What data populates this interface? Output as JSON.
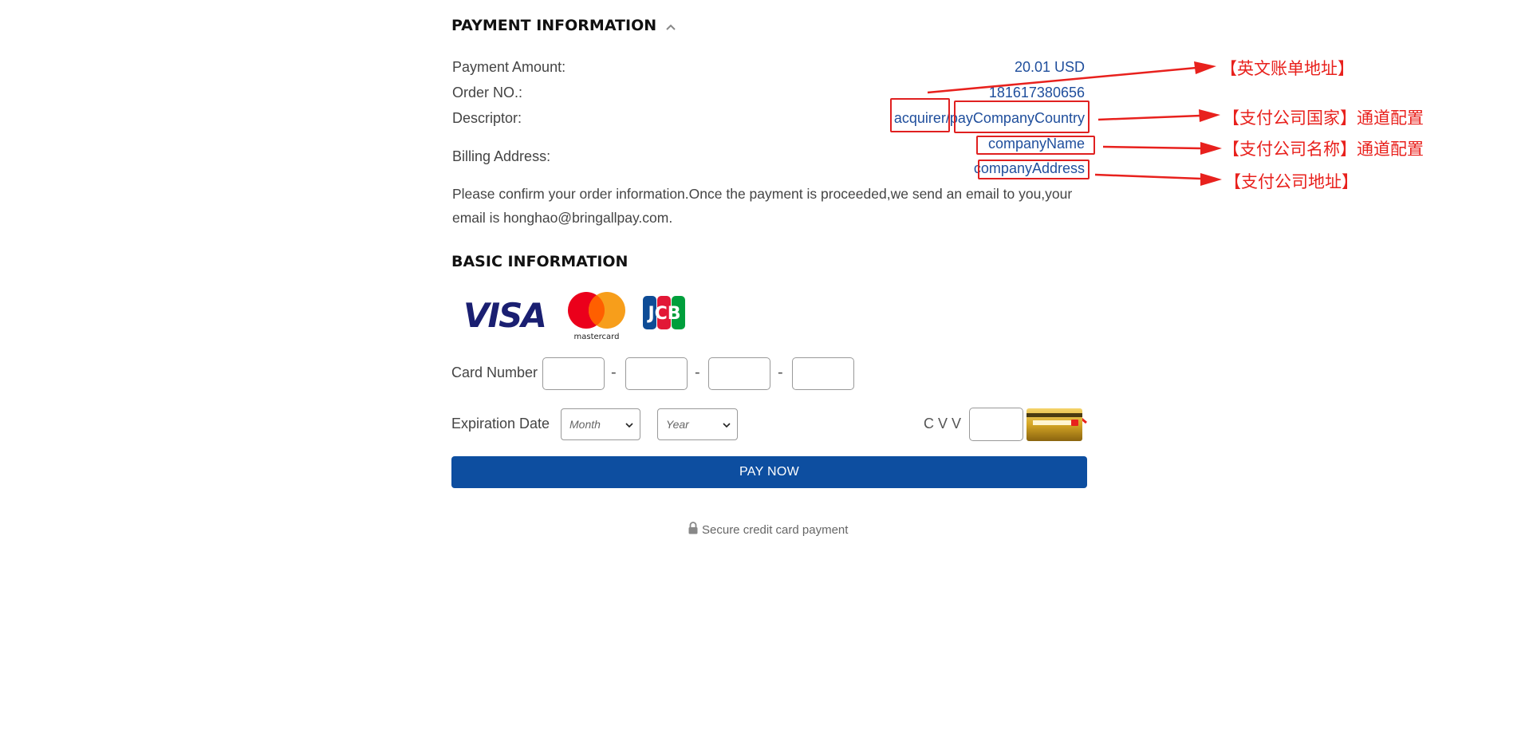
{
  "payment": {
    "title": "PAYMENT INFORMATION",
    "amount_label": "Payment Amount:",
    "amount_value": "20.01 USD",
    "order_label": "Order NO.:",
    "order_value": "181617380656",
    "descriptor_label": "Descriptor:",
    "descriptor_acquirer": "acquirer",
    "descriptor_sep": "/",
    "descriptor_country": "payCompanyCountry",
    "billing_label": "Billing Address:",
    "billing_name": "companyName",
    "billing_address": "companyAddress",
    "confirm_line1": "Please confirm your order information.Once the payment is proceeded,we send an email to you,your",
    "confirm_line2": "email is honghao@bringallpay.com."
  },
  "basic": {
    "title": "BASIC INFORMATION",
    "card_logos": [
      "visa",
      "mastercard",
      "jcb"
    ],
    "card_number_label": "Card Number",
    "dash": "-",
    "expiration_label": "Expiration Date",
    "month_placeholder": "Month",
    "year_placeholder": "Year",
    "cvv_label": "C V V",
    "pay_button": "PAY NOW",
    "secure_text": "Secure credit card payment"
  },
  "annotations": {
    "a1": "【英文账单地址】",
    "a2": "【支付公司国家】通道配置",
    "a3": "【支付公司名称】通道配置",
    "a4": "【支付公司地址】"
  },
  "colors": {
    "accent_blue": "#1f4e9c",
    "button_blue": "#0d4ea0",
    "annotation_red": "#e8211d"
  }
}
